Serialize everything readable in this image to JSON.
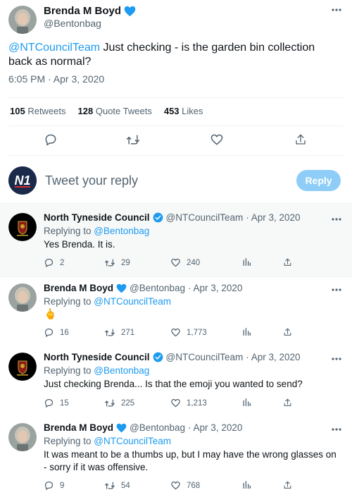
{
  "main_tweet": {
    "author_name": "Brenda M Boyd",
    "author_handle": "@Bentonbag",
    "mention": "@NTCouncilTeam",
    "text": " Just checking - is the garden bin collection back as normal?",
    "timestamp": "6:05 PM · Apr 3, 2020",
    "stats": {
      "retweets_count": "105",
      "retweets_label": "Retweets",
      "quotes_count": "128",
      "quotes_label": "Quote Tweets",
      "likes_count": "453",
      "likes_label": "Likes"
    }
  },
  "reply_box": {
    "placeholder": "Tweet your reply",
    "button_label": "Reply"
  },
  "replies": [
    {
      "name": "North Tyneside Council",
      "handle": "@NTCouncilTeam",
      "date": "· Apr 3, 2020",
      "replying_prefix": "Replying to ",
      "replying_to": "@Bentonbag",
      "text": "Yes Brenda. It is.",
      "reply_count": "2",
      "retweet_count": "29",
      "like_count": "240"
    },
    {
      "name": "Brenda M Boyd",
      "handle": "@Bentonbag",
      "date": "· Apr 3, 2020",
      "replying_prefix": "Replying to ",
      "replying_to": "@NTCouncilTeam",
      "emoji": "🖕",
      "reply_count": "16",
      "retweet_count": "271",
      "like_count": "1,773"
    },
    {
      "name": "North Tyneside Council",
      "handle": "@NTCouncilTeam",
      "date": "· Apr 3, 2020",
      "replying_prefix": "Replying to ",
      "replying_to": "@Bentonbag",
      "text": "Just checking Brenda... Is that the emoji you wanted to send?",
      "reply_count": "15",
      "retweet_count": "225",
      "like_count": "1,213"
    },
    {
      "name": "Brenda M Boyd",
      "handle": "@Bentonbag",
      "date": "· Apr 3, 2020",
      "replying_prefix": "Replying to ",
      "replying_to": "@NTCouncilTeam",
      "text": "It was meant to be a thumbs up, but I may have the wrong glasses on - sorry if it was offensive.",
      "reply_count": "9",
      "retweet_count": "54",
      "like_count": "768"
    }
  ],
  "colors": {
    "accent": "#1d9bf0",
    "verified": "#1d9bf0",
    "council_verified": "#1d9bf0",
    "reply_button": "#8ecdf8",
    "highlight_bg": "#f7f9f9"
  }
}
